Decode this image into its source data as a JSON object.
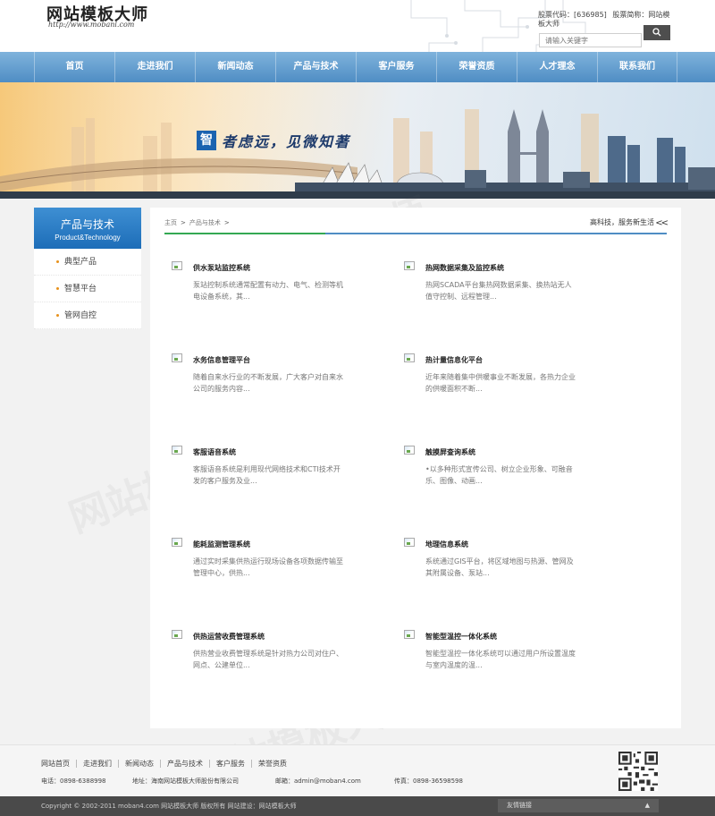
{
  "header": {
    "logo_title": "网站模板大师",
    "logo_sub": "http://www.mobanl.com",
    "stock_code_label": "股票代码：[636985]",
    "stock_name_label": "股票简称：网站模板大师",
    "search_placeholder": "请输入关键字",
    "search_icon": "search-icon"
  },
  "nav": {
    "items": [
      "首页",
      "走进我们",
      "新闻动态",
      "产品与技术",
      "客户服务",
      "荣誉资质",
      "人才理念",
      "联系我们"
    ]
  },
  "banner": {
    "badge": "智",
    "slogan": "者虑远，见微知著"
  },
  "sidebar": {
    "title": "产品与技术",
    "subtitle": "Product&Technology",
    "items": [
      "典型产品",
      "智慧平台",
      "管网自控"
    ]
  },
  "content": {
    "breadcrumb": [
      "主页",
      "产品与技术"
    ],
    "slogan": "高科技，服务新生活",
    "products": [
      {
        "title": "供水泵站监控系统",
        "desc": "泵站控制系统通常配置有动力、电气、检测等机电设备系统，其..."
      },
      {
        "title": "热网数据采集及监控系统",
        "desc": "热网SCADA平台集热网数据采集、换热站无人值守控制、远程管理..."
      },
      {
        "title": "水务信息管理平台",
        "desc": "随着自来水行业的不断发展，广大客户对自来水公司的服务内容..."
      },
      {
        "title": "热计量信息化平台",
        "desc": "近年来随着集中供暖事业不断发展，各热力企业的供暖面积不断..."
      },
      {
        "title": "客服语音系统",
        "desc": "客服语音系统是利用现代网络技术和CTI技术开发的客户服务及业..."
      },
      {
        "title": "触摸屏查询系统",
        "desc": "•以多种形式宣传公司、树立企业形象、可融音乐、图像、动画..."
      },
      {
        "title": "能耗监测管理系统",
        "desc": "通过实时采集供热运行现场设备各项数据传输至管理中心，供热..."
      },
      {
        "title": "地理信息系统",
        "desc": "系统通过GIS平台，将区域地图与热源、管网及其附属设备、泵站..."
      },
      {
        "title": "供热运营收费管理系统",
        "desc": "供热营业收费管理系统是针对热力公司对住户、网点、公建单位..."
      },
      {
        "title": "智能型温控一体化系统",
        "desc": "智能型温控一体化系统可以通过用户所设置温度与室内温度的温..."
      }
    ]
  },
  "footer": {
    "links": [
      "网站首页",
      "走进我们",
      "新闻动态",
      "产品与技术",
      "客户服务",
      "荣誉资质"
    ],
    "phone": "电话：0898-6388998",
    "address": "地址：海南网站模板大师股份有限公司",
    "email": "邮箱：admin@moban4.com",
    "fax": "传真：0898-36598598",
    "copyright": "Copyright © 2002-2011 moban4.com 网站模板大师 版权所有  网站建设：网站模板大师",
    "friend_link": "友情链接",
    "friend_arrow": "▲"
  },
  "colors": {
    "nav": "#4f8dc4",
    "sidebar_head": "#1d6db8",
    "accent_green": "#34a853",
    "bottom_bar": "#4a4a4a"
  }
}
